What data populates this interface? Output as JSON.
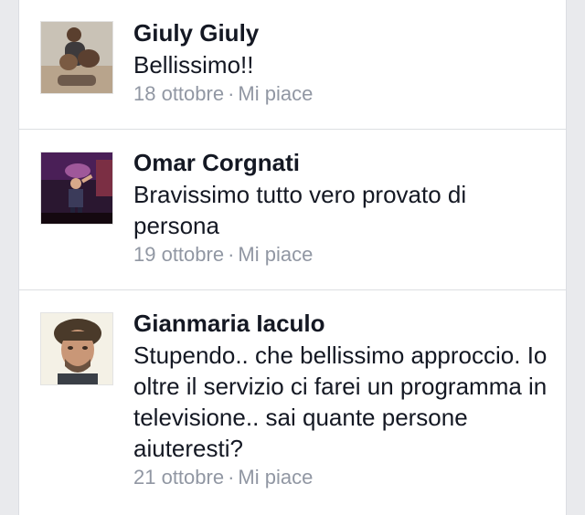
{
  "comments": [
    {
      "author": "Giuly Giuly",
      "text": "Bellissimo!!",
      "date": "18 ottobre",
      "separator": "·",
      "like_label": "Mi piace"
    },
    {
      "author": "Omar Corgnati",
      "text": "Bravissimo tutto vero provato di persona",
      "date": "19 ottobre",
      "separator": "·",
      "like_label": "Mi piace"
    },
    {
      "author": "Gianmaria Iaculo",
      "text": "Stupendo.. che bellissimo approccio. Io oltre il servizio ci farei un programma in televisione.. sai quante persone aiuteresti?",
      "date": "21 ottobre",
      "separator": "·",
      "like_label": "Mi piace"
    }
  ]
}
